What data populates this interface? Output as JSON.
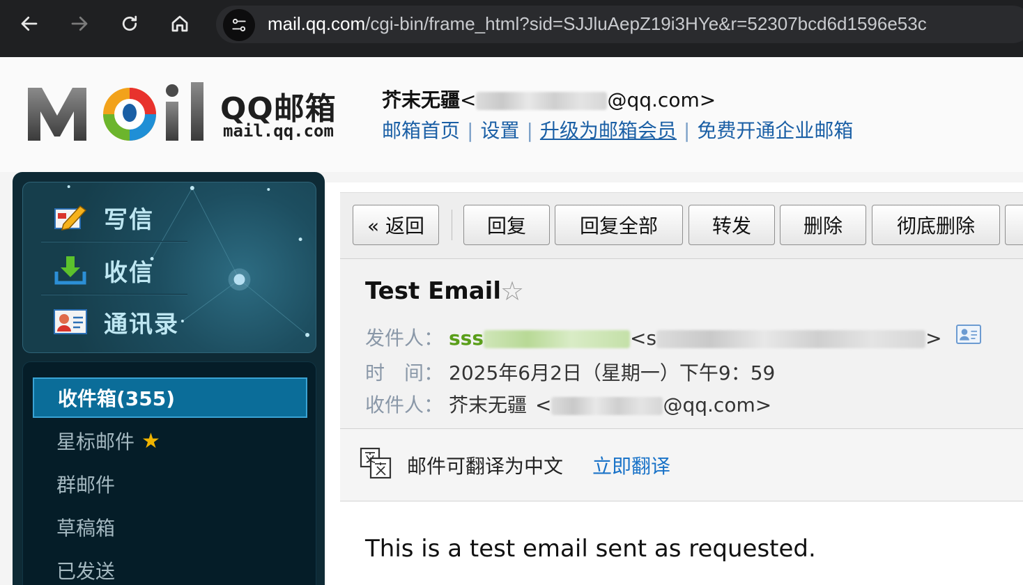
{
  "browser": {
    "url_host": "mail.qq.com",
    "url_path": "/cgi-bin/frame_html?sid=SJJluAepZ19i3HYe&r=52307bcd6d1596e53c"
  },
  "header": {
    "logo_title": "QQ邮箱",
    "logo_sub": "mail.qq.com",
    "user_name": "芥末无疆",
    "user_email_prefix": "<",
    "user_email_suffix": "@qq.com>",
    "links": {
      "home": "邮箱首页",
      "settings": "设置",
      "upgrade": "升级为邮箱会员",
      "enterprise": "免费开通企业邮箱"
    },
    "separator": "|"
  },
  "sidebar": {
    "actions": {
      "compose": "写信",
      "receive": "收信",
      "contacts": "通讯录"
    },
    "folders": {
      "inbox": "收件箱(355)",
      "starred": "星标邮件",
      "group": "群邮件",
      "drafts": "草稿箱",
      "sent": "已发送"
    },
    "starred_badge": "★"
  },
  "toolbar": {
    "back": "« 返回",
    "reply": "回复",
    "reply_all": "回复全部",
    "forward": "转发",
    "delete": "删除",
    "delete_permanent": "彻底删除"
  },
  "mail": {
    "subject": "Test Email",
    "star": "☆",
    "from_label": "发件人：",
    "from_name": "sss",
    "from_email_open": "<s",
    "from_email_close": ">",
    "time_label": "时　间：",
    "time_value": "2025年6月2日（星期一）下午9：59",
    "to_label": "收件人：",
    "to_name": "芥末无疆",
    "to_email_open": "<",
    "to_email_close": "@qq.com>",
    "translate_text": "邮件可翻译为中文",
    "translate_link": "立即翻译",
    "body": "This is a test email sent as requested."
  },
  "colors": {
    "sender_green": "#5a9e1a",
    "link_blue": "#1a73c8",
    "sidebar_active": "#0b6d99"
  },
  "icons": {
    "back": "arrow-left-icon",
    "forward": "arrow-right-icon",
    "reload": "reload-icon",
    "home": "home-icon",
    "site_info": "site-settings-icon",
    "compose": "compose-pencil-icon",
    "receive": "download-tray-icon",
    "contacts": "contact-card-icon",
    "translate": "translate-icon"
  }
}
